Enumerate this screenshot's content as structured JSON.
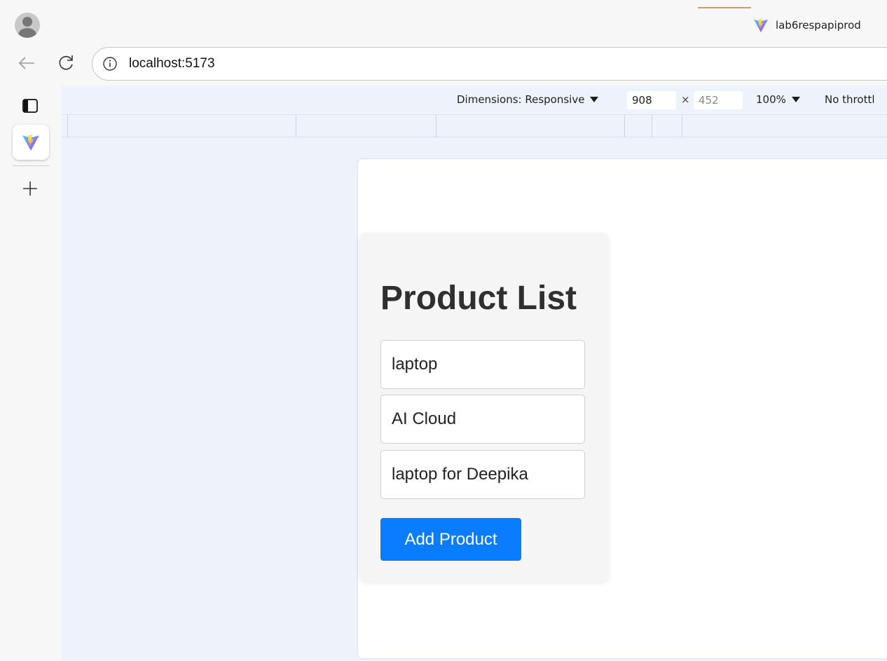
{
  "browser": {
    "tab": {
      "title": "lab6respapiprod",
      "icon": "vite-logo-icon"
    },
    "address_bar": {
      "url": "localhost:5173",
      "icon": "info-icon"
    },
    "nav": {
      "back_icon": "back-arrow-icon",
      "reload_icon": "reload-icon"
    },
    "sidebar": {
      "items": [
        "tab-actions-icon",
        "vite-logo-icon",
        "plus-icon"
      ]
    }
  },
  "device_toolbar": {
    "dimensions_label": "Dimensions: Responsive",
    "width": "908",
    "times_symbol": "×",
    "height": "452",
    "zoom": "100%",
    "throttle": "No throttl"
  },
  "app": {
    "title": "Product List",
    "inputs": [
      {
        "value": "laptop"
      },
      {
        "value": "AI Cloud"
      },
      {
        "value": "laptop for Deepika"
      }
    ],
    "button_label": "Add Product",
    "accent_color": "#0a7cff"
  }
}
